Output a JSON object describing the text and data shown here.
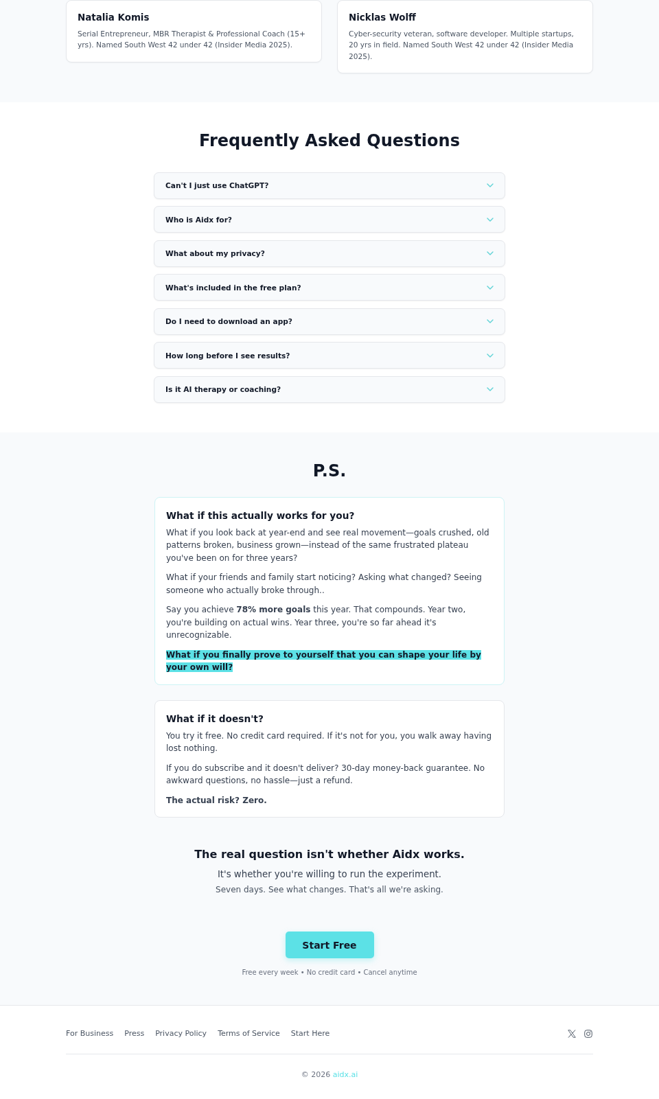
{
  "team": {
    "members": [
      {
        "name": "Natalia Komis",
        "bio": "Serial Entrepreneur, MBR Therapist & Professional Coach (15+ yrs). Named South West 42 under 42 (Insider Media 2025)."
      },
      {
        "name": "Nicklas Wolff",
        "bio": "Cyber-security veteran, software developer. Multiple startups, 20 yrs in field. Named South West 42 under 42 (Insider Media 2025)."
      }
    ]
  },
  "faq": {
    "title": "Frequently Asked Questions",
    "items": [
      {
        "question": "Can't I just use ChatGPT?",
        "expanded": false
      },
      {
        "question": "Who is Aidx for?",
        "expanded": false
      },
      {
        "question": "What about my privacy?",
        "expanded": false
      },
      {
        "question": "What's included in the free plan?",
        "expanded": false
      },
      {
        "question": "Do I need to download an app?",
        "expanded": false
      },
      {
        "question": "How long before I see results?",
        "expanded": false
      },
      {
        "question": "Is it AI therapy or coaching?",
        "expanded": false
      }
    ]
  },
  "ps": {
    "title": "P.S.",
    "cards": [
      {
        "heading": "What if this actually works for you?",
        "featured": true,
        "paragraphs": [
          {
            "kind": "body",
            "text": "What if you look back at year-end and see real movement—goals crushed, old patterns broken, business grown—instead of the same frustrated plateau you've been on for three years?"
          },
          {
            "kind": "body",
            "text": "What if your friends and family start noticing? Asking what changed? Seeing someone who actually broke through.."
          },
          {
            "kind": "body",
            "text": "Say you achieve **78% more goals** this year. That compounds. Year two, you're building on actual wins. Year three, you're so far ahead it's unrecognizable."
          },
          {
            "kind": "highlight",
            "text": "What if you finally prove to yourself that you can shape your life by your own will?"
          }
        ]
      },
      {
        "heading": "What if it doesn't?",
        "featured": false,
        "paragraphs": [
          {
            "kind": "body",
            "text": "You try it free. No credit card required. If it's not for you, you walk away having lost nothing."
          },
          {
            "kind": "body",
            "text": "If you do subscribe and it doesn't deliver? 30-day money-back guarantee. No awkward questions, no hassle—just a refund."
          },
          {
            "kind": "strong",
            "text": "The actual risk? Zero."
          }
        ]
      }
    ],
    "closing": {
      "headline": "The real question isn't whether Aidx works.",
      "subline": "It's whether you're willing to run the experiment.",
      "note": "Seven days. See what changes. That's all we're asking."
    },
    "cta": {
      "label": "Start Free",
      "note": "Free every week • No credit card • Cancel anytime"
    }
  },
  "footer": {
    "links": [
      "For Business",
      "Press",
      "Privacy Policy",
      "Terms of Service",
      "Start Here"
    ],
    "copyright": "© 2026",
    "site_link": "aidx.ai"
  }
}
